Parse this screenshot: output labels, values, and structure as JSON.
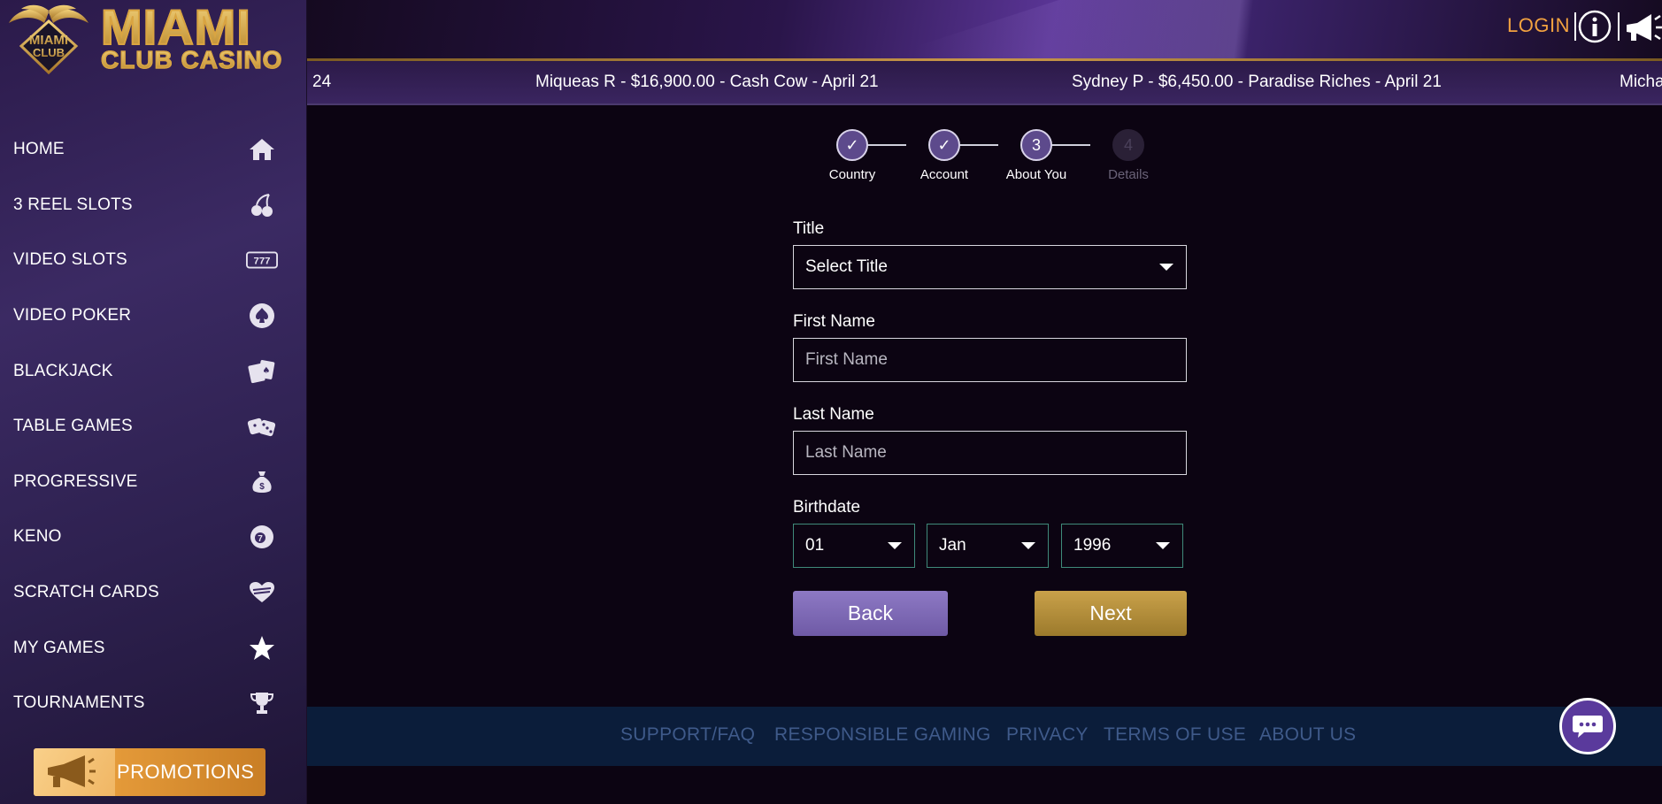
{
  "brand": {
    "emblem_text_top": "MIAMI",
    "emblem_text_bottom": "CLUB",
    "name_line1": "MIAMI",
    "name_line2": "CLUB CASINO"
  },
  "header": {
    "login_label": "LOGIN",
    "icons": [
      "info-icon",
      "megaphone-icon"
    ]
  },
  "ticker": {
    "items": [
      "24",
      "Miqueas R - $16,900.00 - Cash Cow - April 21",
      "Sydney P - $6,450.00 - Paradise Riches - April 21",
      "Micha"
    ]
  },
  "sidebar": {
    "items": [
      {
        "label": "HOME",
        "icon": "home-icon"
      },
      {
        "label": "3 REEL SLOTS",
        "icon": "cherries-icon"
      },
      {
        "label": "VIDEO SLOTS",
        "icon": "slot-777-icon"
      },
      {
        "label": "VIDEO POKER",
        "icon": "spade-icon"
      },
      {
        "label": "BLACKJACK",
        "icon": "cards-icon"
      },
      {
        "label": "TABLE GAMES",
        "icon": "dice-icon"
      },
      {
        "label": "PROGRESSIVE",
        "icon": "money-bag-icon"
      },
      {
        "label": "KENO",
        "icon": "keno-ball-icon"
      },
      {
        "label": "SCRATCH CARDS",
        "icon": "scratch-heart-icon"
      },
      {
        "label": "MY GAMES",
        "icon": "star-icon"
      },
      {
        "label": "TOURNAMENTS",
        "icon": "trophy-icon"
      }
    ],
    "promotions_label": "PROMOTIONS"
  },
  "steps": [
    {
      "label": "Country",
      "marker": "✓",
      "state": "done"
    },
    {
      "label": "Account",
      "marker": "✓",
      "state": "done"
    },
    {
      "label": "About You",
      "marker": "3",
      "state": "current"
    },
    {
      "label": "Details",
      "marker": "4",
      "state": "inactive"
    }
  ],
  "form": {
    "title_label": "Title",
    "title_value": "Select Title",
    "first_name_label": "First Name",
    "first_name_placeholder": "First Name",
    "last_name_label": "Last Name",
    "last_name_placeholder": "Last Name",
    "birthdate_label": "Birthdate",
    "birth_day": "01",
    "birth_month": "Jan",
    "birth_year": "1996",
    "back_label": "Back",
    "next_label": "Next"
  },
  "footer": {
    "links": [
      "SUPPORT/FAQ",
      "RESPONSIBLE GAMING",
      "PRIVACY",
      "TERMS OF USE",
      "ABOUT US"
    ]
  },
  "colors": {
    "accent_gold": "#f2a240",
    "back_button": "#7c68b4",
    "next_button": "#b58f3c",
    "footer_bg": "#0b1d3a",
    "footer_link": "#3f5a8a"
  }
}
